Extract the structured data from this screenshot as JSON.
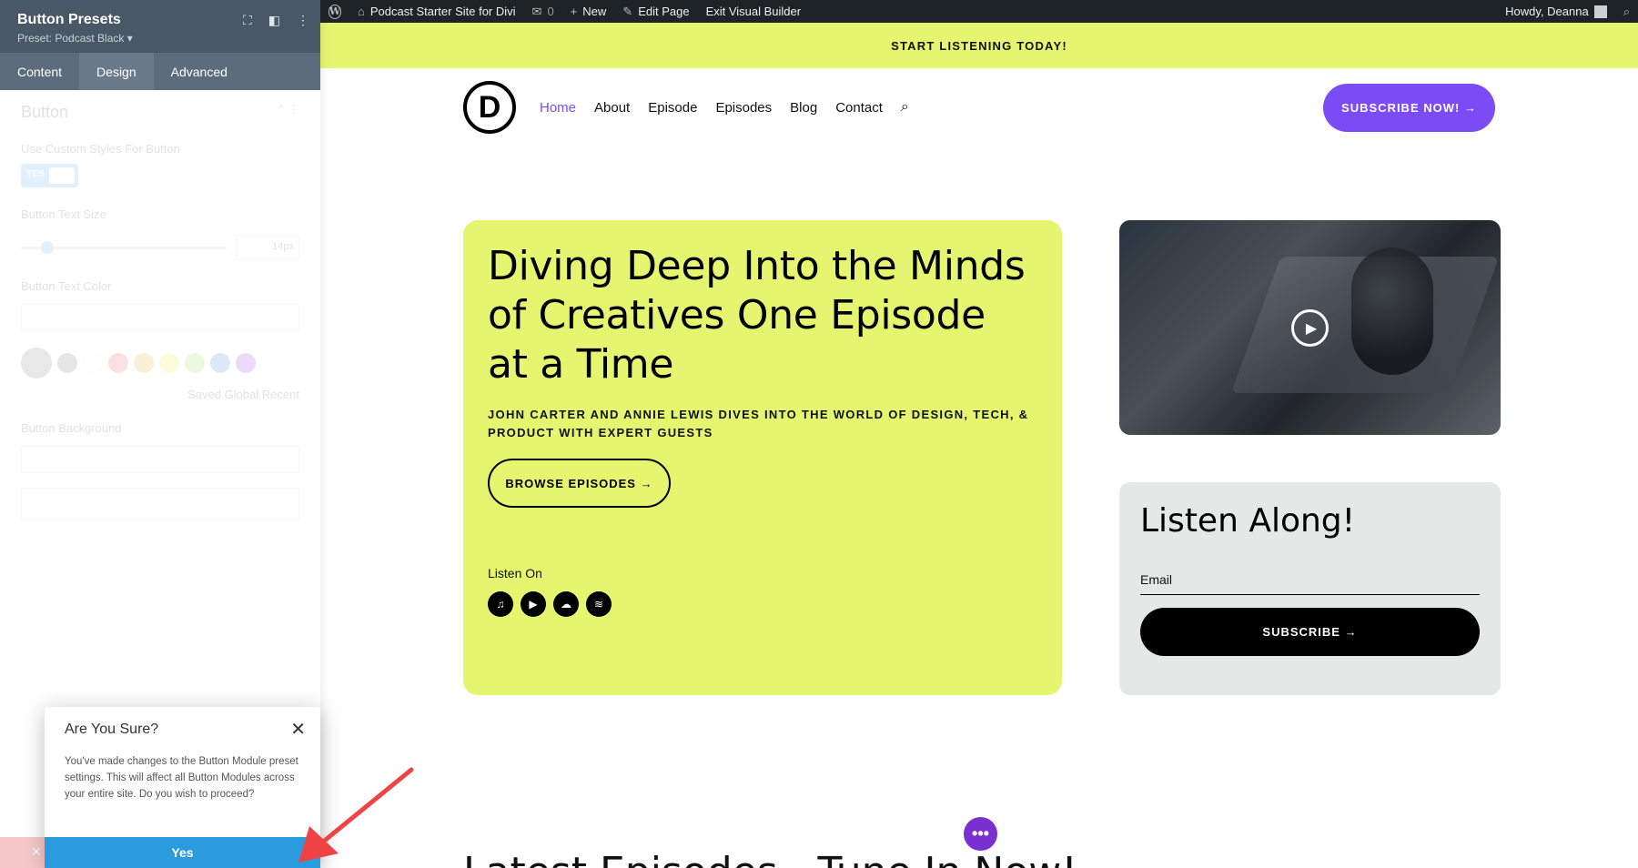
{
  "admin_bar": {
    "site_name": "Podcast Starter Site for Divi",
    "comments_count": "0",
    "new_label": "New",
    "edit_page": "Edit Page",
    "exit_builder": "Exit Visual Builder",
    "howdy": "Howdy, Deanna"
  },
  "site": {
    "banner": "START LISTENING TODAY!",
    "logo_letter": "D",
    "menu": [
      "Home",
      "About",
      "Episode",
      "Episodes",
      "Blog",
      "Contact"
    ],
    "nav_cta": "SUBSCRIBE NOW! →",
    "hero": {
      "title": "Diving Deep Into the Minds of Creatives One Episode at a Time",
      "subtitle": "JOHN CARTER AND ANNIE LEWIS DIVES INTO THE WORLD OF DESIGN, TECH, & PRODUCT WITH EXPERT GUESTS",
      "button": "BROWSE EPISODES →",
      "listen_on": "Listen On"
    },
    "listen_card": {
      "title": "Listen Along!",
      "email_label": "Email",
      "button": "SUBSCRIBE →"
    },
    "fab": "•••",
    "bottom_heading": "Latest Episodes - Tune In Now!"
  },
  "panel": {
    "title": "Button Presets",
    "preset": "Preset: Podcast Black ▾",
    "tabs": [
      "Content",
      "Design",
      "Advanced"
    ],
    "active_tab": "Design",
    "section_title": "Button",
    "labels": {
      "custom_styles": "Use Custom Styles For Button",
      "toggle_value": "YES",
      "text_size": "Button Text Size",
      "text_size_value": "14px",
      "text_color": "Button Text Color",
      "palette_tabs": "Saved   Global   Recent",
      "background": "Button Background"
    }
  },
  "modal": {
    "title": "Are You Sure?",
    "body": "You've made changes to the Button Module preset settings. This will affect all Button Modules across your entire site. Do you wish to proceed?",
    "yes": "Yes"
  },
  "colors": {
    "accent_lime": "#e5f56f",
    "accent_purple": "#7b4bf6",
    "panel_header": "#495866",
    "confirm_blue": "#2a9cde",
    "arrow_red": "#ef4444"
  }
}
